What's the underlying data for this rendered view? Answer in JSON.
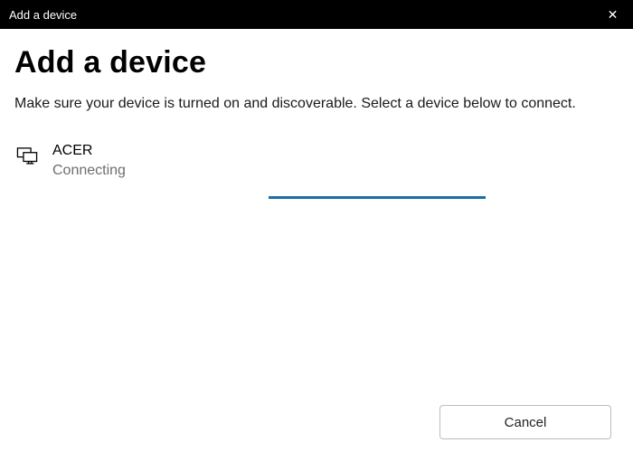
{
  "titlebar": {
    "title": "Add a device",
    "close_glyph": "✕"
  },
  "heading": "Add a device",
  "instruction": "Make sure your device is turned on and discoverable. Select a device below to connect.",
  "device": {
    "name": "ACER",
    "status": "Connecting",
    "icon": "displays-icon"
  },
  "progress": {
    "indeterminate": true,
    "accent_color": "#1b6ea5"
  },
  "footer": {
    "cancel_label": "Cancel"
  }
}
